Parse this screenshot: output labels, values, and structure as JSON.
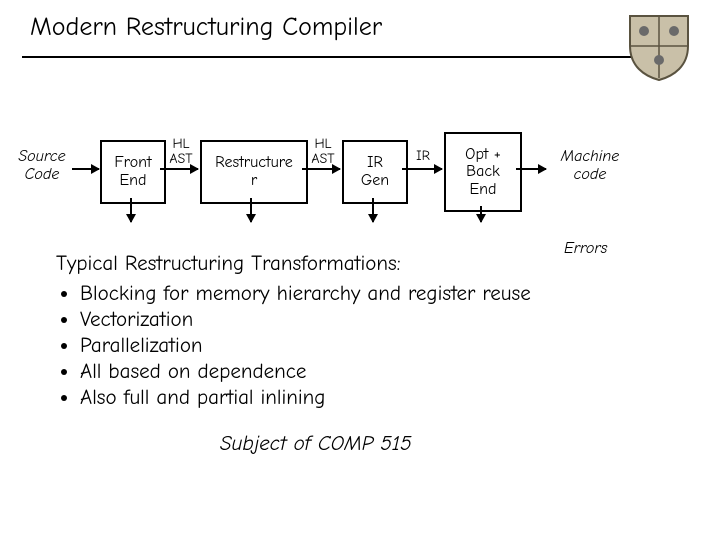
{
  "title": "Modern Restructuring Compiler",
  "pipeline": {
    "input": "Source\nCode",
    "stage1": "Front\nEnd",
    "edge12": "HL\nAST",
    "stage2": "Restructure\nr",
    "edge23": "HL\nAST",
    "stage3": "IR\nGen",
    "edge34": "IR",
    "stage4": "Opt +\nBack\nEnd",
    "output": "Machine\ncode",
    "error": "Errors"
  },
  "body_lead": "Typical Restructuring Transformations:",
  "bullets": [
    "Blocking for memory hierarchy and register reuse",
    "Vectorization",
    "Parallelization",
    "All based on dependence",
    "Also full and partial inlining"
  ],
  "footer": "Subject of COMP 515"
}
